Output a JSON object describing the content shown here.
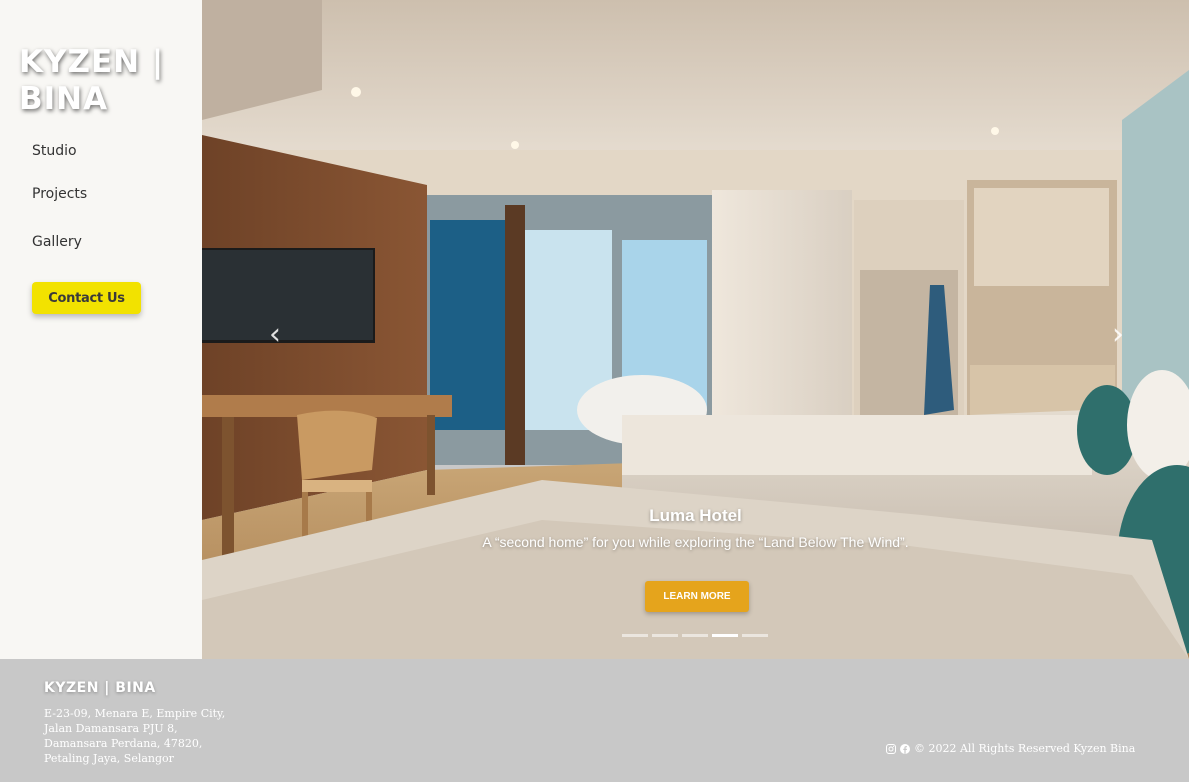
{
  "sidebar": {
    "brand": "KYZEN | BINA",
    "nav": [
      {
        "label": "Studio"
      },
      {
        "label": "Projects"
      },
      {
        "label": "Gallery"
      }
    ],
    "contact_label": "Contact Us"
  },
  "carousel": {
    "slide_title": "Luma Hotel",
    "slide_text": "A “second home” for you while exploring the “Land Below The Wind”.",
    "button_label": "LEARN MORE",
    "indicator_count": 5,
    "active_index": 3,
    "prev_icon": "chevron-left-icon",
    "next_icon": "chevron-right-icon"
  },
  "footer": {
    "brand": "KYZEN | BINA",
    "address": [
      "E-23-09, Menara E, Empire City,",
      "Jalan Damansara PJU 8,",
      "Damansara Perdana, 47820,",
      "Petaling Jaya, Selangor"
    ],
    "copyright": "© 2022 All Rights Reserved Kyzen Bina",
    "social_icons": [
      "instagram-icon",
      "facebook-icon"
    ]
  },
  "colors": {
    "accent_yellow": "#f2e200",
    "learn_more": "#e5a41c",
    "footer_bg": "#c8c8c8",
    "sidebar_bg": "#f8f7f4"
  }
}
